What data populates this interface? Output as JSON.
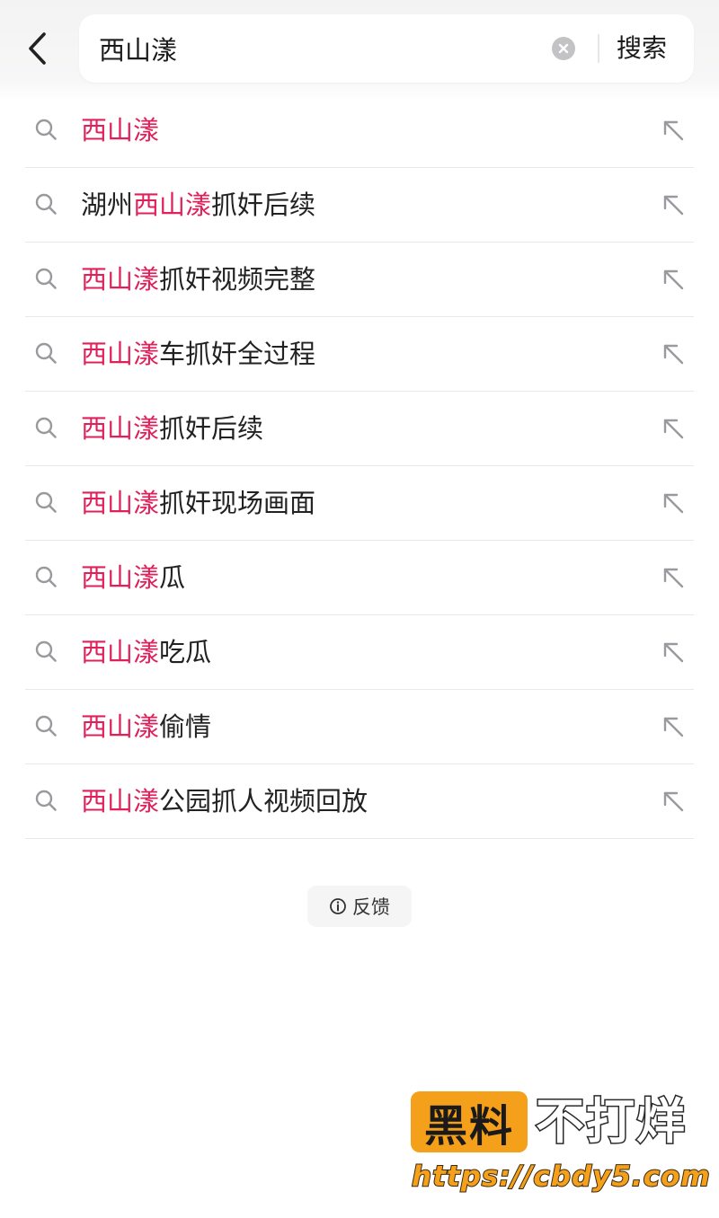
{
  "header": {
    "back_icon": "chevron-left-icon",
    "search_value": "西山漾",
    "clear_icon": "clear-circle-icon",
    "search_label": "搜索"
  },
  "suggestions": [
    {
      "highlight": "西山漾",
      "prefix": "",
      "suffix": ""
    },
    {
      "highlight": "西山漾",
      "prefix": "湖州",
      "suffix": "抓奸后续"
    },
    {
      "highlight": "西山漾",
      "prefix": "",
      "suffix": "抓奸视频完整"
    },
    {
      "highlight": "西山漾",
      "prefix": "",
      "suffix": "车抓奸全过程"
    },
    {
      "highlight": "西山漾",
      "prefix": "",
      "suffix": "抓奸后续"
    },
    {
      "highlight": "西山漾",
      "prefix": "",
      "suffix": "抓奸现场画面"
    },
    {
      "highlight": "西山漾",
      "prefix": "",
      "suffix": "瓜"
    },
    {
      "highlight": "西山漾",
      "prefix": "",
      "suffix": "吃瓜"
    },
    {
      "highlight": "西山漾",
      "prefix": "",
      "suffix": "偷情"
    },
    {
      "highlight": "西山漾",
      "prefix": "",
      "suffix": "公园抓人视频回放"
    }
  ],
  "feedback": {
    "icon": "info-icon",
    "label": "反馈"
  },
  "watermark": {
    "box_text": "黑料",
    "text": "不打烊",
    "url": "https://cbdy5.com"
  },
  "colors": {
    "highlight": "#e0205a",
    "watermark_accent": "#f5a01a"
  }
}
